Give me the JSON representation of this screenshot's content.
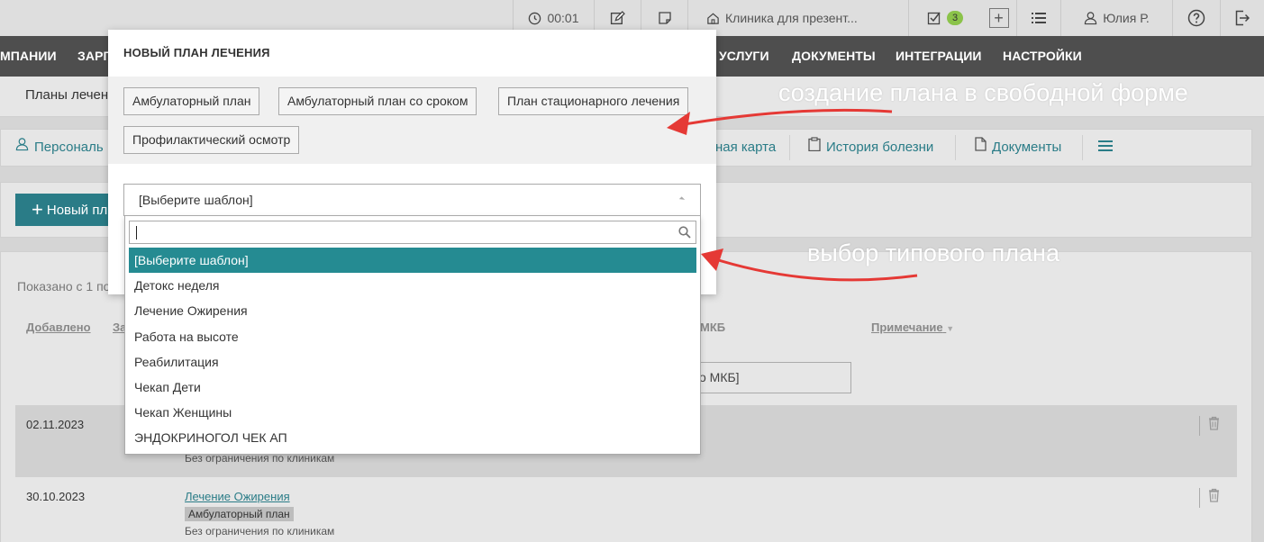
{
  "topbar": {
    "timer": "00:01",
    "clinic": "Клиника для презент...",
    "tasks_count": "3",
    "user": "Юлия Р."
  },
  "nav": [
    "МПАНИИ",
    "ЗАРГ",
    "УСЛУГИ",
    "ДОКУМЕНТЫ",
    "ИНТЕГРАЦИИ",
    "НАСТРОЙКИ"
  ],
  "breadcrumb": "Планы лечен",
  "tabs": {
    "personal": "Персональ",
    "card": "ная карта",
    "history": "История болезни",
    "documents": "Документы"
  },
  "new_button": "Новый пл",
  "table": {
    "shown_text": "Показано с 1 по",
    "col_added": "Добавлено",
    "col_z": "За",
    "col_mkb": "МКБ",
    "col_note": "Примечание",
    "mkb_filter": "о МКБ]",
    "rows": [
      {
        "date": "02.11.2023",
        "note": "Без ограничения по клиникам"
      },
      {
        "date": "30.10.2023",
        "link": "Лечение Ожирения",
        "tag": "Амбулаторный план",
        "note": "Без ограничения по клиникам"
      }
    ]
  },
  "modal": {
    "title": "НОВЫЙ ПЛАН ЛЕЧЕНИЯ",
    "options": [
      "Амбулаторный план",
      "Амбулаторный план со сроком",
      "План стационарного лечения",
      "Профилактический осмотр"
    ],
    "select_value": "[Выберите шаблон]"
  },
  "dropdown": {
    "search_value": "",
    "items": [
      "[Выберите шаблон]",
      "Детокс неделя",
      "Лечение Ожирения",
      "Работа на высоте",
      "Реабилитация",
      "Чекап Дети",
      "Чекап Женщины",
      "ЭНДОКРИНОГОЛ ЧЕК АП"
    ],
    "selected_index": 0
  },
  "annotations": {
    "free_form": "создание плана в свободной форме",
    "template": "выбор типового плана",
    "arrow_color": "#e53935"
  }
}
